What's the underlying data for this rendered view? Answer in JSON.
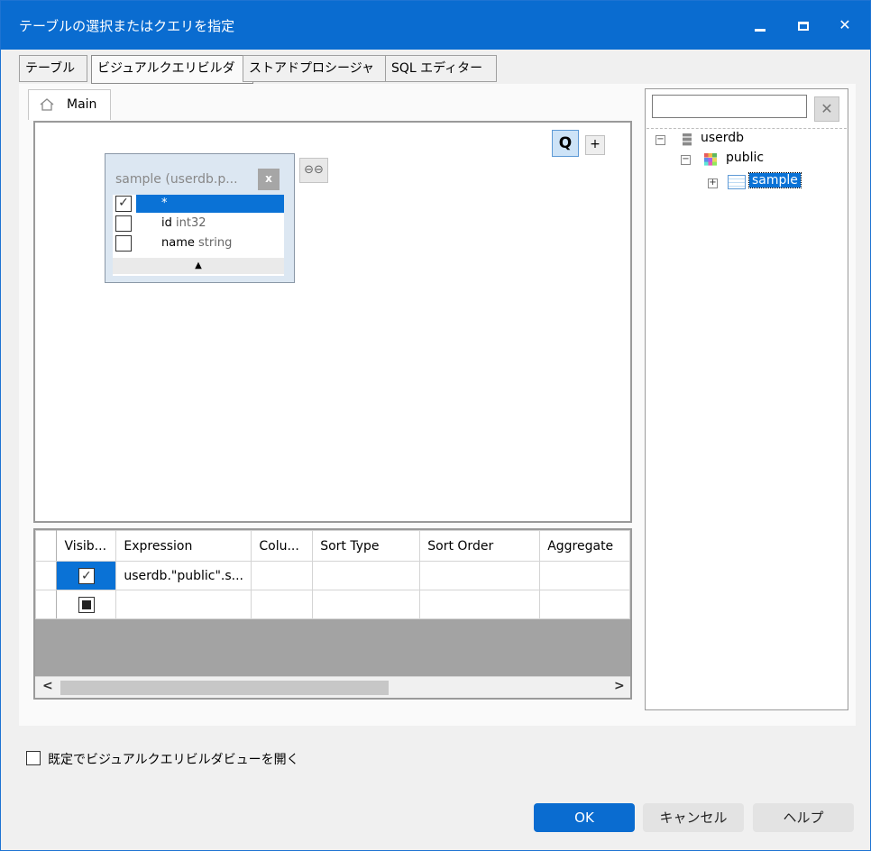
{
  "window": {
    "title": "テーブルの選択またはクエリを指定",
    "min_glyph": "_",
    "close_glyph": "✕"
  },
  "tabs": [
    {
      "label": "テーブル"
    },
    {
      "label": "ビジュアルクエリビルダ"
    },
    {
      "label": "ストアドプロシージャ"
    },
    {
      "label": "SQL エディター"
    }
  ],
  "active_tab": "ビジュアルクエリビルダ",
  "doc_tab": {
    "label": "Main"
  },
  "design": {
    "q_label": "Q",
    "plus_label": "+",
    "table_box": {
      "title": "sample (userdb.p...",
      "close_label": "x",
      "fields": [
        {
          "checked": true,
          "name": "*",
          "type": "",
          "selected": true
        },
        {
          "checked": false,
          "name": "id",
          "type": "int32",
          "selected": false
        },
        {
          "checked": false,
          "name": "name",
          "type": "string",
          "selected": false
        }
      ],
      "footer_glyph": "▲"
    },
    "link_glyph": "⊖⊖"
  },
  "grid": {
    "columns": [
      "Visib...",
      "Expression",
      "Colu...",
      "Sort Type",
      "Sort Order",
      "Aggregate"
    ],
    "rows": [
      {
        "visible": true,
        "expression": "userdb.\"public\".s...",
        "column": "",
        "sort_type": "",
        "sort_order": "",
        "aggregate": ""
      },
      {
        "visible": "indeterminate",
        "expression": "",
        "column": "",
        "sort_type": "",
        "sort_order": "",
        "aggregate": ""
      }
    ],
    "scroll_left": "<",
    "scroll_right": ">"
  },
  "tree": {
    "search_value": "",
    "search_placeholder": "",
    "clear_label": "✕",
    "nodes": {
      "db": {
        "label": "userdb"
      },
      "schema": {
        "label": "public"
      },
      "table": {
        "label": "sample"
      }
    }
  },
  "footer": {
    "open_default_label": "既定でビジュアルクエリビルダビューを開く",
    "ok": "OK",
    "cancel": "キャンセル",
    "help": "ヘルプ"
  },
  "colors": {
    "accent": "#0a6cd0",
    "selection": "#0a72d6"
  }
}
